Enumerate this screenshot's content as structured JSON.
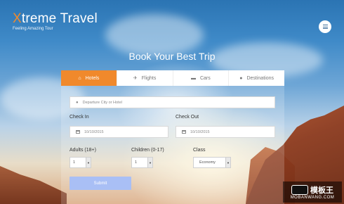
{
  "brand": {
    "title_first": "X",
    "title_rest": "treme Travel",
    "subtitle": "Feeling Amazing Tour"
  },
  "heading": "Book Your Best Trip",
  "tabs": [
    {
      "label": "Hotels",
      "icon": "home-icon",
      "active": true
    },
    {
      "label": "Flights",
      "icon": "plane-icon",
      "active": false
    },
    {
      "label": "Cars",
      "icon": "car-icon",
      "active": false
    },
    {
      "label": "Destinations",
      "icon": "map-pin-icon",
      "active": false
    }
  ],
  "form": {
    "departure_placeholder": "Departure City or Hotel",
    "checkin_label": "Check In",
    "checkin_value": "10/10/2015",
    "checkout_label": "Check Out",
    "checkout_value": "10/10/2015",
    "adults_label": "Adults (18+)",
    "adults_value": "1",
    "children_label": "Children (0-17)",
    "children_value": "1",
    "class_label": "Class",
    "class_value": "Economy",
    "submit_label": "Submit"
  },
  "watermark": {
    "text": "模板王",
    "url": "MOBANWANG.COM"
  },
  "colors": {
    "accent": "#f0892c",
    "submit": "#a9bff5"
  }
}
